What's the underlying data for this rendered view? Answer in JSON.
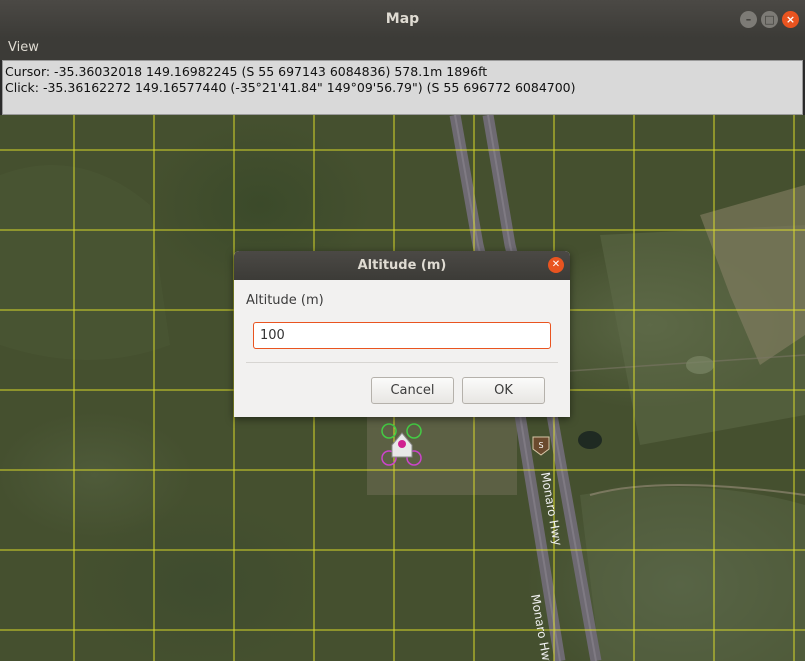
{
  "window": {
    "title": "Map",
    "controls": [
      "minimize-icon",
      "maximize-icon",
      "close-icon"
    ]
  },
  "menubar": {
    "items": [
      "View"
    ]
  },
  "info": {
    "cursor": "Cursor: -35.36032018 149.16982245 (S 55 697143 6084836) 578.1m 1896ft",
    "click": "Click: -35.36162272 149.16577440 (-35°21'41.84\" 149°09'56.79\") (S 55 696772 6084700)"
  },
  "map": {
    "road_labels": [
      "Monaro Hwy",
      "Monaro Hwy"
    ],
    "route_shield": "S",
    "grid_color": "#e6e62a"
  },
  "dialog": {
    "title": "Altitude (m)",
    "label": "Altitude (m)",
    "input_value": "100",
    "cancel_label": "Cancel",
    "ok_label": "OK"
  },
  "colors": {
    "accent": "#e95420",
    "titlebar": "#3c3b37"
  }
}
